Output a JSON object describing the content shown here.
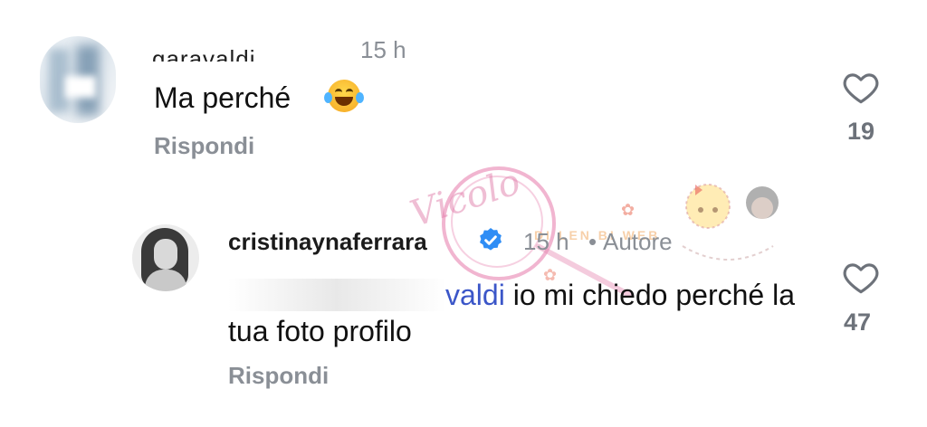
{
  "comments": [
    {
      "username": "garavaldi",
      "time": "15 h",
      "text": "Ma perché",
      "emoji_icon": "face-with-tears-of-joy-icon",
      "reply_label": "Rispondi",
      "likes": "19"
    },
    {
      "username": "cristinaynaferrara",
      "verified_icon": "verified-badge-icon",
      "time": "15 h",
      "separator": "•",
      "author_tag": "Autore",
      "mention": "valdi",
      "text": " io mi chiedo perché la tua foto profilo",
      "reply_label": "Rispondi",
      "likes": "47"
    }
  ],
  "watermark": {
    "script_text": "Vicolo",
    "small_text": "DI LEN BI WEB"
  },
  "colors": {
    "text": "#111111",
    "muted": "#8a8f96",
    "mention": "#3b56c8",
    "verified": "#2f8df5",
    "background": "#ffffff"
  }
}
